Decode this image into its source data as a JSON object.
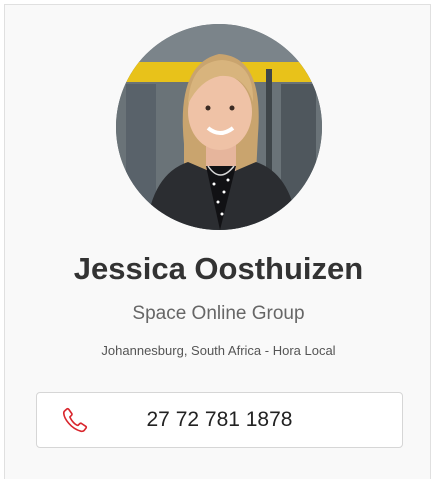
{
  "profile": {
    "photo_alt": "profile-photo",
    "name": "Jessica Oosthuizen",
    "company": "Space Online Group",
    "location": "Johannesburg, South Africa - Hora Local"
  },
  "contact": {
    "phone_icon": "phone-icon",
    "phone_number": "27 72 781 1878"
  },
  "colors": {
    "accent": "#d9262d",
    "name_text": "#333333",
    "muted_text": "#666666"
  }
}
